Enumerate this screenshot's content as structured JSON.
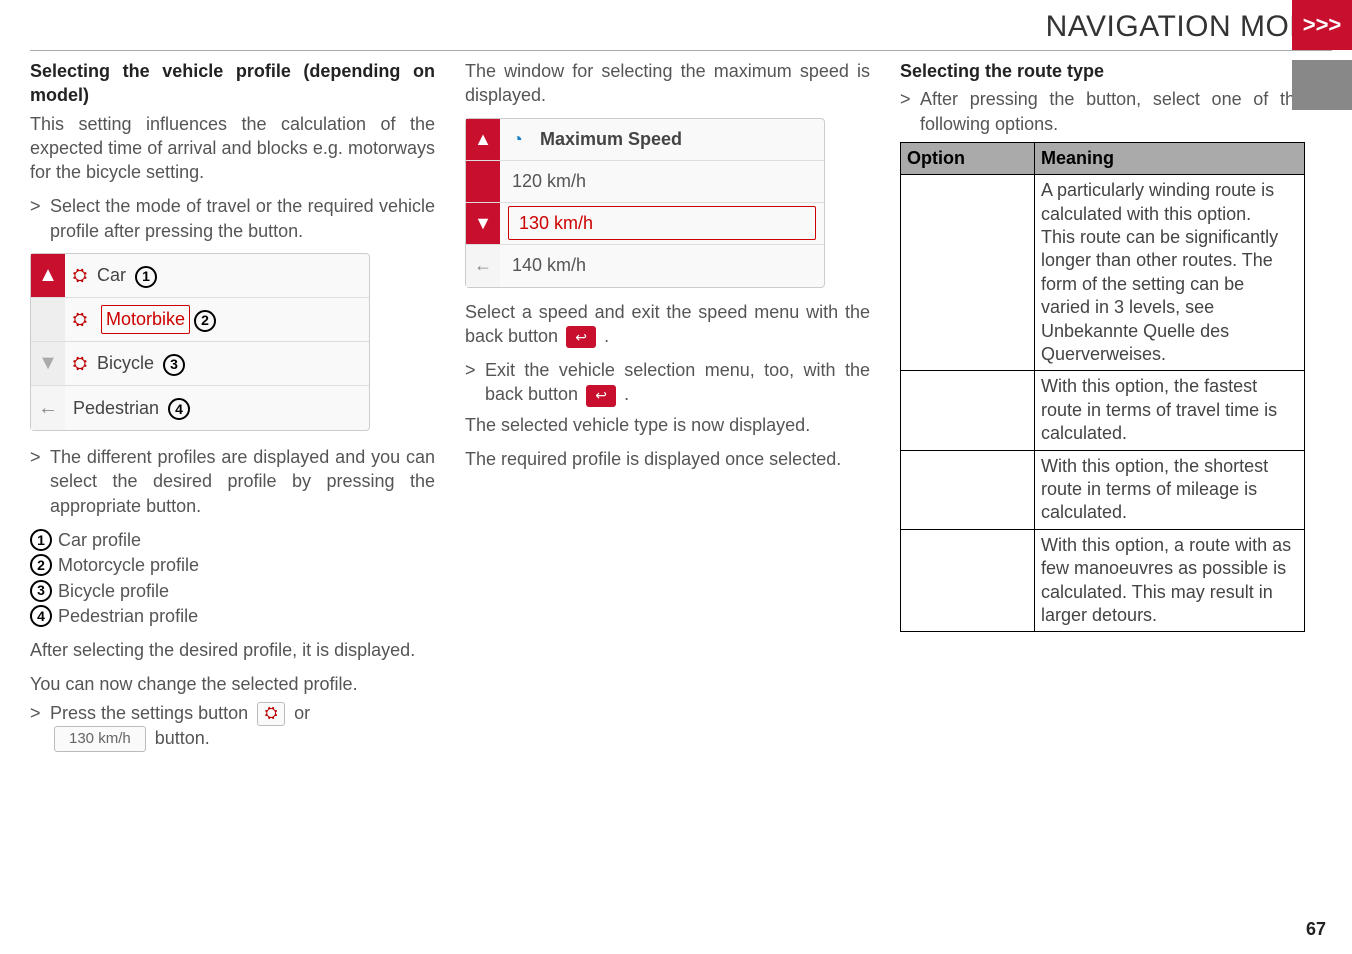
{
  "header": {
    "title": "NAVIGATION MODE",
    "chevrons": ">>>"
  },
  "col1": {
    "h": "Selecting the vehicle profile (depending on model)",
    "p1": "This setting influences the calculation of the expected time of arrival and blocks e.g. motorways for the bicycle setting.",
    "gt1a": ">",
    "gt1b": "Select the mode of travel or the required vehicle profile after pressing the               button.",
    "profiles": {
      "car": "Car",
      "motorbike": "Motorbike",
      "bicycle": "Bicycle",
      "pedestrian": "Pedestrian"
    },
    "gt2a": ">",
    "gt2b": "The different profiles are displayed and you can select the desired profile by pressing the appropriate button.",
    "leg1": "Car profile",
    "leg2": "Motorcycle profile",
    "leg3": "Bicycle profile",
    "leg4": "Pedestrian profile",
    "p2": "After selecting the desired profile, it is displayed.",
    "p3": "You can now change the selected profile.",
    "gt3a": ">",
    "gt3b_pre": "Press the settings button",
    "gt3b_post": "or",
    "gt3c": "button.",
    "speed_btn": "130 km/h"
  },
  "col2": {
    "p1": "The window for selecting the maximum speed is displayed.",
    "speed_header": "Maximum Speed",
    "speed1": "120 km/h",
    "speed2": "130 km/h",
    "speed3": "140 km/h",
    "p2_pre": "Select a speed and exit the speed menu with the back button",
    "p2_post": ".",
    "gt1a": ">",
    "gt1b_pre": "Exit the vehicle selection menu, too, with the back button",
    "gt1b_post": ".",
    "p3": "The selected vehicle type is now displayed.",
    "p4": "The required profile is displayed once selected."
  },
  "col3": {
    "h": "Selecting the route type",
    "gt1a": ">",
    "gt1b": "After pressing the                  button, select one of the following options.",
    "th1": "Option",
    "th2": "Meaning",
    "r1": "A particularly winding route is calculated with this option.\nThis route can be significantly longer than other routes. The form of the setting can be varied in 3 levels, see Unbekannte Quelle des Querverweises.",
    "r2": "With this option, the fastest route in terms of travel time is calculated.",
    "r3": "With this option, the shortest route in terms of mileage is calculated.",
    "r4": "With this option, a route with as few manoeuvres as possible is calculated. This may result in larger detours."
  },
  "page_number": "67"
}
